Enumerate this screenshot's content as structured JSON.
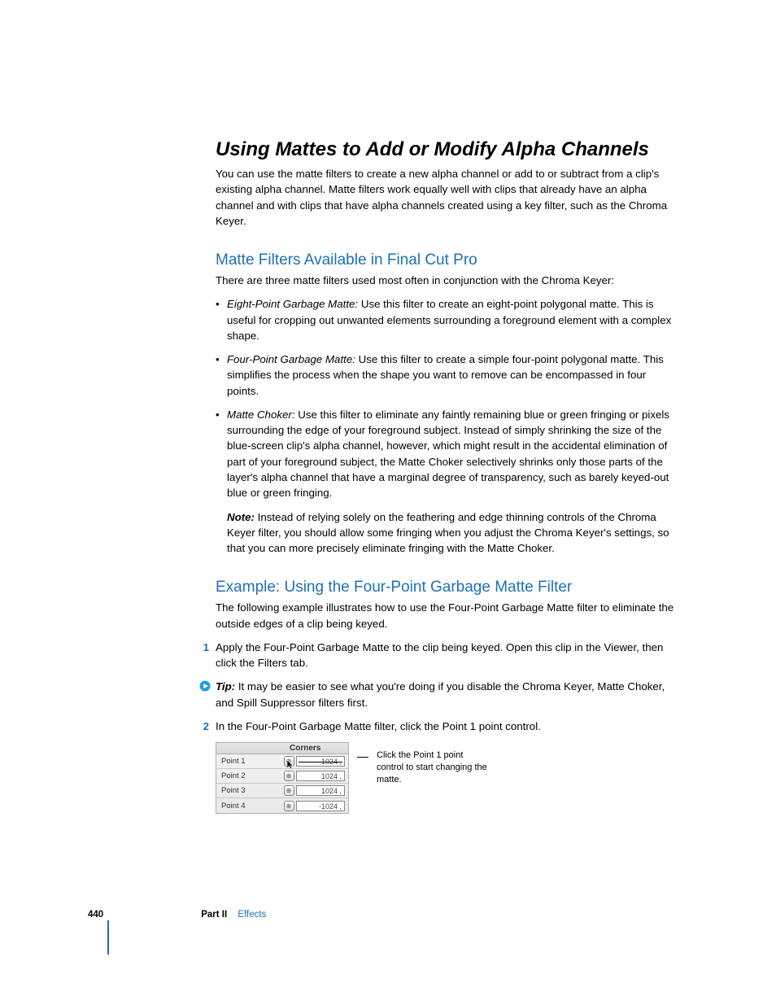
{
  "headings": {
    "main": "Using Mattes to Add or Modify Alpha Channels",
    "section1": "Matte Filters Available in Final Cut Pro",
    "section2": "Example:  Using the Four-Point Garbage Matte Filter"
  },
  "intro": "You can use the matte filters to create a new alpha channel or add to or subtract from a clip's existing alpha channel. Matte filters work equally well with clips that already have an alpha channel and with clips that have alpha channels created using a key filter, such as the Chroma Keyer.",
  "filters_intro": "There are three matte filters used most often in conjunction with the Chroma Keyer:",
  "bullets": [
    {
      "term": "Eight-Point Garbage Matte:",
      "text": "  Use this filter to create an eight-point polygonal matte. This is useful for cropping out unwanted elements surrounding a foreground element with a complex shape."
    },
    {
      "term": "Four-Point Garbage Matte:",
      "text": "  Use this filter to create a simple four-point polygonal matte. This simplifies the process when the shape you want to remove can be encompassed in four points."
    },
    {
      "term": "Matte Choker:",
      "text": "  Use this filter to eliminate any faintly remaining blue or green fringing or pixels surrounding the edge of your foreground subject. Instead of simply shrinking the size of the blue-screen clip's alpha channel, however, which might result in the accidental elimination of part of your foreground subject, the Matte Choker selectively shrinks only those parts of the layer's alpha channel that have a marginal degree of transparency, such as barely keyed-out blue or green fringing."
    }
  ],
  "note": {
    "label": "Note:",
    "text": "  Instead of relying solely on the feathering and edge thinning controls of the Chroma Keyer filter, you should allow some fringing when you adjust the Chroma Keyer's settings, so that you can more precisely eliminate fringing with the Matte Choker."
  },
  "example_intro": "The following example illustrates how to use the Four-Point Garbage Matte filter to eliminate the outside edges of a clip being keyed.",
  "steps": {
    "s1_num": "1",
    "s1_text": "Apply the Four-Point Garbage Matte to the clip being keyed. Open this clip in the Viewer, then click the Filters tab.",
    "s2_num": "2",
    "s2_text": "In the Four-Point Garbage Matte filter, click the Point 1 point control."
  },
  "tip": {
    "label": "Tip:",
    "text": "  It may be easier to see what you're doing if you disable the Chroma Keyer, Matte Choker, and Spill Suppressor filters first."
  },
  "panel": {
    "header": "Corners",
    "rows": [
      {
        "label": "Point 1",
        "value": "-1024 ,",
        "strike": true,
        "cursor": true
      },
      {
        "label": "Point 2",
        "value": "1024 ,",
        "strike": false,
        "cursor": false
      },
      {
        "label": "Point 3",
        "value": "1024 ,",
        "strike": false,
        "cursor": false
      },
      {
        "label": "Point 4",
        "value": "-1024 ,",
        "strike": false,
        "cursor": false
      }
    ]
  },
  "callout": "Click the Point 1 point control to start changing the matte.",
  "footer": {
    "page_number": "440",
    "part_label": "Part II",
    "part_name": "Effects"
  }
}
